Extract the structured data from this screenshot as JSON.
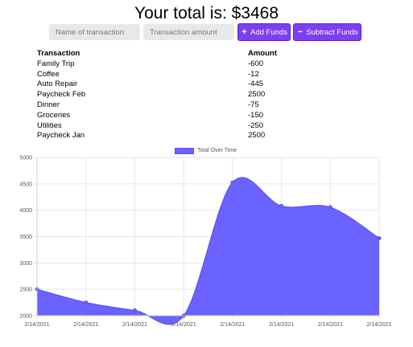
{
  "header": {
    "title": "Your total is: $3468"
  },
  "form": {
    "name_placeholder": "Name of transaction",
    "amount_placeholder": "Transaction amount",
    "add_label": "Add Funds",
    "subtract_label": "Subtract Funds"
  },
  "table": {
    "headers": [
      "Transaction",
      "Amount"
    ],
    "rows": [
      [
        "Family Trip",
        "-600"
      ],
      [
        "Coffee",
        "-12"
      ],
      [
        "Auto Repair",
        "-445"
      ],
      [
        "Paycheck Feb",
        "2500"
      ],
      [
        "Dinner",
        "-75"
      ],
      [
        "Groceries",
        "-150"
      ],
      [
        "Utilities",
        "-250"
      ],
      [
        "Paycheck Jan",
        "2500"
      ]
    ]
  },
  "colors": {
    "accent": "#7e3ff2",
    "series_fill": "#6b63ff",
    "series_line": "#5a52ee"
  },
  "chart_data": {
    "type": "area",
    "x": [
      "2/14/2021",
      "2/14/2021",
      "2/14/2021",
      "2/14/2021",
      "2/14/2021",
      "2/14/2021",
      "2/14/2021",
      "2/14/2021"
    ],
    "series": [
      {
        "name": "Total Over Time",
        "values": [
          2500,
          2250,
          2100,
          2000,
          4525,
          4080,
          4055,
          3468
        ]
      }
    ],
    "ylim": [
      2000,
      5000
    ],
    "yticks": [
      2000,
      2500,
      3000,
      3500,
      4000,
      4500,
      5000
    ],
    "grid": true,
    "legend": "top-center"
  }
}
